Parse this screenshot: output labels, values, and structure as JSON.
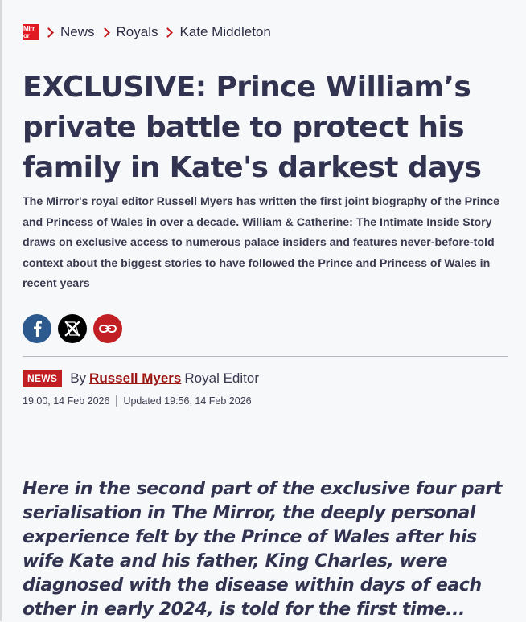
{
  "breadcrumb": {
    "logo_text_line1": "Mirr",
    "logo_text_line2": "or",
    "items": [
      {
        "label": "News"
      },
      {
        "label": "Royals"
      },
      {
        "label": "Kate Middleton"
      }
    ]
  },
  "article": {
    "headline": "EXCLUSIVE: Prince William’s private battle to protect his family in Kate's darkest days",
    "standfirst": "The Mirror's royal editor Russell Myers has written the first joint biography of the Prince and Princess of Wales in over a decade. William & Catherine: The Intimate Inside Story draws on exclusive access to numerous palace insiders and features never-before-told context about the biggest stories to have followed the Prince and Princess of Wales in recent years",
    "share": {
      "icons": [
        "facebook-icon",
        "x-icon",
        "link-icon"
      ]
    },
    "badge": "NEWS",
    "byline_prefix": "By",
    "author": "Russell Myers",
    "author_role": "Royal Editor",
    "published": "19:00, 14 Feb 2026",
    "updated": "Updated 19:56, 14 Feb 2026",
    "intro": "Here in the second part of the exclusive four part serialisation in The Mirror, the deeply personal experience felt by the Prince of Wales after his wife Kate and his father, King Charles, were diagnosed with the disease within days of each other in early 2024, is told for the first time..."
  },
  "colors": {
    "brand_red": "#c21f24",
    "facebook_blue": "#2c5a8e",
    "text_dark": "#323350"
  }
}
